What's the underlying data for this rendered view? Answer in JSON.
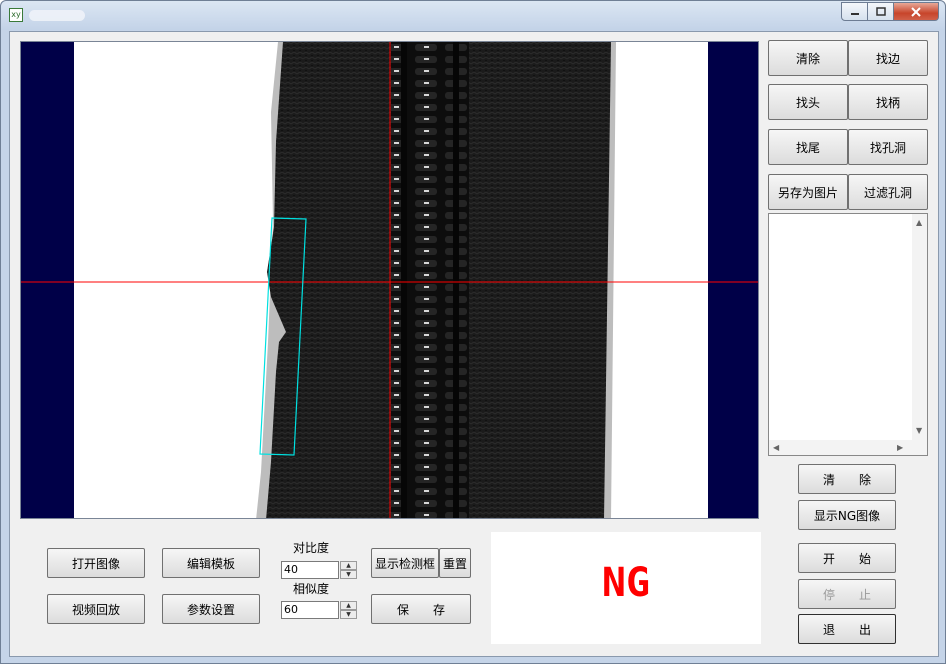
{
  "window": {
    "icon_text": "xy",
    "colors": {
      "accent_red": "#ff0000",
      "roi_cyan": "#00e0e0",
      "viewer_bg": "#000048"
    }
  },
  "titlebar_icons": [
    "minimize-icon",
    "maximize-icon",
    "close-icon"
  ],
  "right_panel": {
    "clear": "清除",
    "find_edge": "找边",
    "find_head": "找头",
    "find_handle": "找柄",
    "find_tail": "找尾",
    "find_hole": "找孔洞",
    "save_as_image": "另存为图片",
    "filter_hole": "过滤孔洞",
    "clear2": "清　　除",
    "show_ng": "显示NG图像",
    "start": "开　　始",
    "stop": "停　　止",
    "exit": "退　　出"
  },
  "bottom": {
    "open_image": "打开图像",
    "edit_template": "编辑模板",
    "video_playback": "视频回放",
    "param_settings": "参数设置",
    "contrast_label": "对比度",
    "contrast_value": "40",
    "similarity_label": "相似度",
    "similarity_value": "60",
    "show_box": "显示检测框",
    "reset": "重置",
    "save": "保　　存"
  },
  "result": {
    "text": "NG",
    "color": "#ff0000"
  }
}
